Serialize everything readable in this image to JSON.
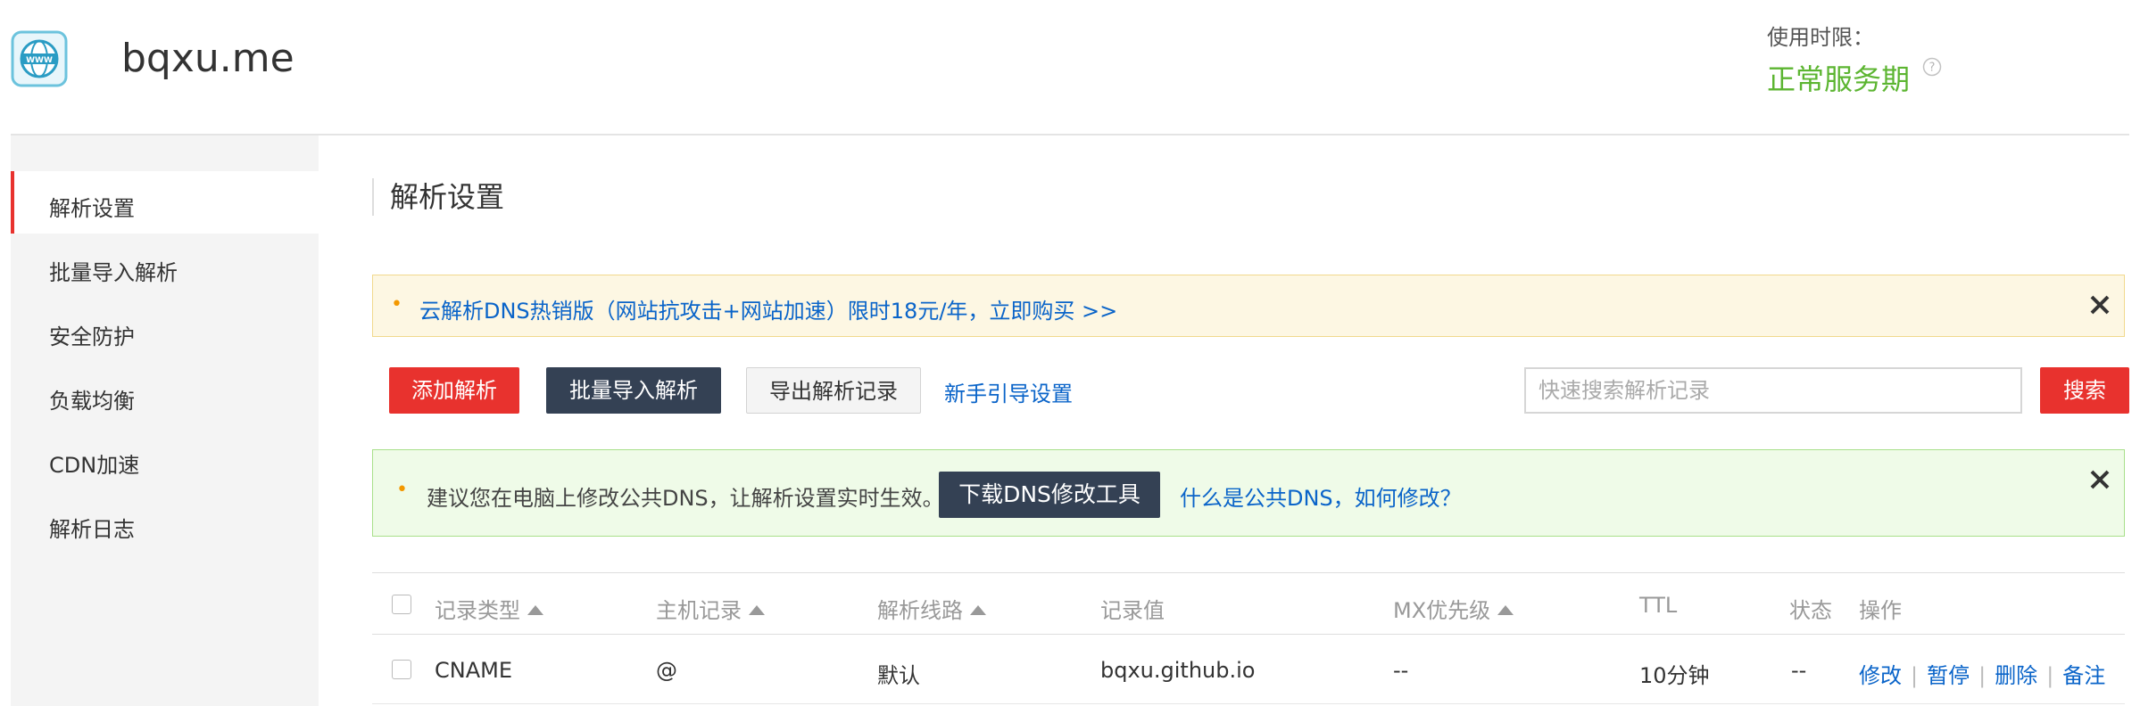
{
  "header": {
    "domain": "bqxu.me",
    "term_label": "使用时限：",
    "term_value": "正常服务期"
  },
  "sidebar": {
    "items": [
      {
        "label": "解析设置",
        "active": true
      },
      {
        "label": "批量导入解析",
        "active": false
      },
      {
        "label": "安全防护",
        "active": false
      },
      {
        "label": "负载均衡",
        "active": false
      },
      {
        "label": "CDN加速",
        "active": false
      },
      {
        "label": "解析日志",
        "active": false
      }
    ]
  },
  "main": {
    "title": "解析设置",
    "promo": {
      "bullet": "•",
      "text": "云解析DNS热销版（网站抗攻击+网站加速）限时18元/年，立即购买 >>"
    },
    "toolbar": {
      "add": "添加解析",
      "batch_import": "批量导入解析",
      "export": "导出解析记录",
      "guide": "新手引导设置",
      "search_placeholder": "快速搜索解析记录",
      "search": "搜索"
    },
    "tip": {
      "bullet": "•",
      "text": "建议您在电脑上修改公共DNS，让解析设置实时生效。",
      "download": "下载DNS修改工具",
      "link": "什么是公共DNS，如何修改？"
    },
    "table": {
      "headers": {
        "type": "记录类型",
        "host": "主机记录",
        "line": "解析线路",
        "value": "记录值",
        "mx": "MX优先级",
        "ttl": "TTL",
        "status": "状态",
        "ops": "操作"
      },
      "rows": [
        {
          "type": "CNAME",
          "host": "@",
          "line": "默认",
          "value": "bqxu.github.io",
          "mx": "--",
          "ttl": "10分钟",
          "status": "--",
          "ops": [
            "修改",
            "暂停",
            "删除",
            "备注"
          ],
          "sep": "|"
        }
      ]
    }
  },
  "colors": {
    "brand_red": "#e8322e",
    "dark_button": "#344154",
    "link_blue": "#0a64c9",
    "ok_green": "#5cb531"
  }
}
